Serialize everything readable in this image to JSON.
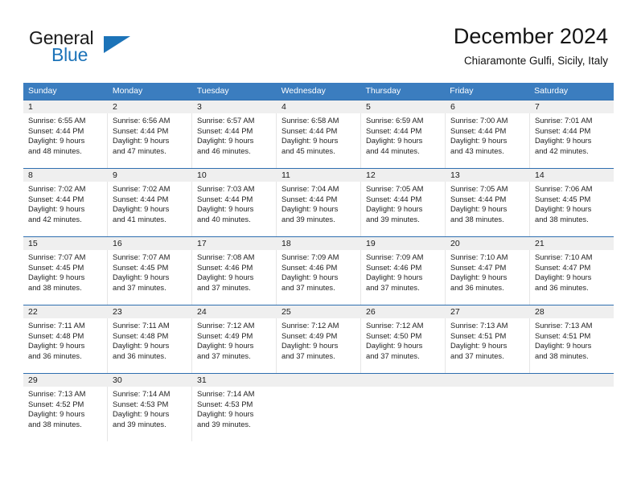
{
  "brand": {
    "name_part1": "General",
    "name_part2": "Blue",
    "accent_color": "#1c73b8"
  },
  "header": {
    "title": "December 2024",
    "subtitle": "Chiaramonte Gulfi, Sicily, Italy"
  },
  "calendar": {
    "weekday_headers": [
      "Sunday",
      "Monday",
      "Tuesday",
      "Wednesday",
      "Thursday",
      "Friday",
      "Saturday"
    ],
    "header_bg_color": "#3b7dbf",
    "daynum_bg_color": "#efefef",
    "weeks": [
      [
        {
          "day": "1",
          "sunrise": "Sunrise: 6:55 AM",
          "sunset": "Sunset: 4:44 PM",
          "daylight1": "Daylight: 9 hours",
          "daylight2": "and 48 minutes."
        },
        {
          "day": "2",
          "sunrise": "Sunrise: 6:56 AM",
          "sunset": "Sunset: 4:44 PM",
          "daylight1": "Daylight: 9 hours",
          "daylight2": "and 47 minutes."
        },
        {
          "day": "3",
          "sunrise": "Sunrise: 6:57 AM",
          "sunset": "Sunset: 4:44 PM",
          "daylight1": "Daylight: 9 hours",
          "daylight2": "and 46 minutes."
        },
        {
          "day": "4",
          "sunrise": "Sunrise: 6:58 AM",
          "sunset": "Sunset: 4:44 PM",
          "daylight1": "Daylight: 9 hours",
          "daylight2": "and 45 minutes."
        },
        {
          "day": "5",
          "sunrise": "Sunrise: 6:59 AM",
          "sunset": "Sunset: 4:44 PM",
          "daylight1": "Daylight: 9 hours",
          "daylight2": "and 44 minutes."
        },
        {
          "day": "6",
          "sunrise": "Sunrise: 7:00 AM",
          "sunset": "Sunset: 4:44 PM",
          "daylight1": "Daylight: 9 hours",
          "daylight2": "and 43 minutes."
        },
        {
          "day": "7",
          "sunrise": "Sunrise: 7:01 AM",
          "sunset": "Sunset: 4:44 PM",
          "daylight1": "Daylight: 9 hours",
          "daylight2": "and 42 minutes."
        }
      ],
      [
        {
          "day": "8",
          "sunrise": "Sunrise: 7:02 AM",
          "sunset": "Sunset: 4:44 PM",
          "daylight1": "Daylight: 9 hours",
          "daylight2": "and 42 minutes."
        },
        {
          "day": "9",
          "sunrise": "Sunrise: 7:02 AM",
          "sunset": "Sunset: 4:44 PM",
          "daylight1": "Daylight: 9 hours",
          "daylight2": "and 41 minutes."
        },
        {
          "day": "10",
          "sunrise": "Sunrise: 7:03 AM",
          "sunset": "Sunset: 4:44 PM",
          "daylight1": "Daylight: 9 hours",
          "daylight2": "and 40 minutes."
        },
        {
          "day": "11",
          "sunrise": "Sunrise: 7:04 AM",
          "sunset": "Sunset: 4:44 PM",
          "daylight1": "Daylight: 9 hours",
          "daylight2": "and 39 minutes."
        },
        {
          "day": "12",
          "sunrise": "Sunrise: 7:05 AM",
          "sunset": "Sunset: 4:44 PM",
          "daylight1": "Daylight: 9 hours",
          "daylight2": "and 39 minutes."
        },
        {
          "day": "13",
          "sunrise": "Sunrise: 7:05 AM",
          "sunset": "Sunset: 4:44 PM",
          "daylight1": "Daylight: 9 hours",
          "daylight2": "and 38 minutes."
        },
        {
          "day": "14",
          "sunrise": "Sunrise: 7:06 AM",
          "sunset": "Sunset: 4:45 PM",
          "daylight1": "Daylight: 9 hours",
          "daylight2": "and 38 minutes."
        }
      ],
      [
        {
          "day": "15",
          "sunrise": "Sunrise: 7:07 AM",
          "sunset": "Sunset: 4:45 PM",
          "daylight1": "Daylight: 9 hours",
          "daylight2": "and 38 minutes."
        },
        {
          "day": "16",
          "sunrise": "Sunrise: 7:07 AM",
          "sunset": "Sunset: 4:45 PM",
          "daylight1": "Daylight: 9 hours",
          "daylight2": "and 37 minutes."
        },
        {
          "day": "17",
          "sunrise": "Sunrise: 7:08 AM",
          "sunset": "Sunset: 4:46 PM",
          "daylight1": "Daylight: 9 hours",
          "daylight2": "and 37 minutes."
        },
        {
          "day": "18",
          "sunrise": "Sunrise: 7:09 AM",
          "sunset": "Sunset: 4:46 PM",
          "daylight1": "Daylight: 9 hours",
          "daylight2": "and 37 minutes."
        },
        {
          "day": "19",
          "sunrise": "Sunrise: 7:09 AM",
          "sunset": "Sunset: 4:46 PM",
          "daylight1": "Daylight: 9 hours",
          "daylight2": "and 37 minutes."
        },
        {
          "day": "20",
          "sunrise": "Sunrise: 7:10 AM",
          "sunset": "Sunset: 4:47 PM",
          "daylight1": "Daylight: 9 hours",
          "daylight2": "and 36 minutes."
        },
        {
          "day": "21",
          "sunrise": "Sunrise: 7:10 AM",
          "sunset": "Sunset: 4:47 PM",
          "daylight1": "Daylight: 9 hours",
          "daylight2": "and 36 minutes."
        }
      ],
      [
        {
          "day": "22",
          "sunrise": "Sunrise: 7:11 AM",
          "sunset": "Sunset: 4:48 PM",
          "daylight1": "Daylight: 9 hours",
          "daylight2": "and 36 minutes."
        },
        {
          "day": "23",
          "sunrise": "Sunrise: 7:11 AM",
          "sunset": "Sunset: 4:48 PM",
          "daylight1": "Daylight: 9 hours",
          "daylight2": "and 36 minutes."
        },
        {
          "day": "24",
          "sunrise": "Sunrise: 7:12 AM",
          "sunset": "Sunset: 4:49 PM",
          "daylight1": "Daylight: 9 hours",
          "daylight2": "and 37 minutes."
        },
        {
          "day": "25",
          "sunrise": "Sunrise: 7:12 AM",
          "sunset": "Sunset: 4:49 PM",
          "daylight1": "Daylight: 9 hours",
          "daylight2": "and 37 minutes."
        },
        {
          "day": "26",
          "sunrise": "Sunrise: 7:12 AM",
          "sunset": "Sunset: 4:50 PM",
          "daylight1": "Daylight: 9 hours",
          "daylight2": "and 37 minutes."
        },
        {
          "day": "27",
          "sunrise": "Sunrise: 7:13 AM",
          "sunset": "Sunset: 4:51 PM",
          "daylight1": "Daylight: 9 hours",
          "daylight2": "and 37 minutes."
        },
        {
          "day": "28",
          "sunrise": "Sunrise: 7:13 AM",
          "sunset": "Sunset: 4:51 PM",
          "daylight1": "Daylight: 9 hours",
          "daylight2": "and 38 minutes."
        }
      ],
      [
        {
          "day": "29",
          "sunrise": "Sunrise: 7:13 AM",
          "sunset": "Sunset: 4:52 PM",
          "daylight1": "Daylight: 9 hours",
          "daylight2": "and 38 minutes."
        },
        {
          "day": "30",
          "sunrise": "Sunrise: 7:14 AM",
          "sunset": "Sunset: 4:53 PM",
          "daylight1": "Daylight: 9 hours",
          "daylight2": "and 39 minutes."
        },
        {
          "day": "31",
          "sunrise": "Sunrise: 7:14 AM",
          "sunset": "Sunset: 4:53 PM",
          "daylight1": "Daylight: 9 hours",
          "daylight2": "and 39 minutes."
        },
        {
          "day": "",
          "sunrise": "",
          "sunset": "",
          "daylight1": "",
          "daylight2": ""
        },
        {
          "day": "",
          "sunrise": "",
          "sunset": "",
          "daylight1": "",
          "daylight2": ""
        },
        {
          "day": "",
          "sunrise": "",
          "sunset": "",
          "daylight1": "",
          "daylight2": ""
        },
        {
          "day": "",
          "sunrise": "",
          "sunset": "",
          "daylight1": "",
          "daylight2": ""
        }
      ]
    ]
  }
}
